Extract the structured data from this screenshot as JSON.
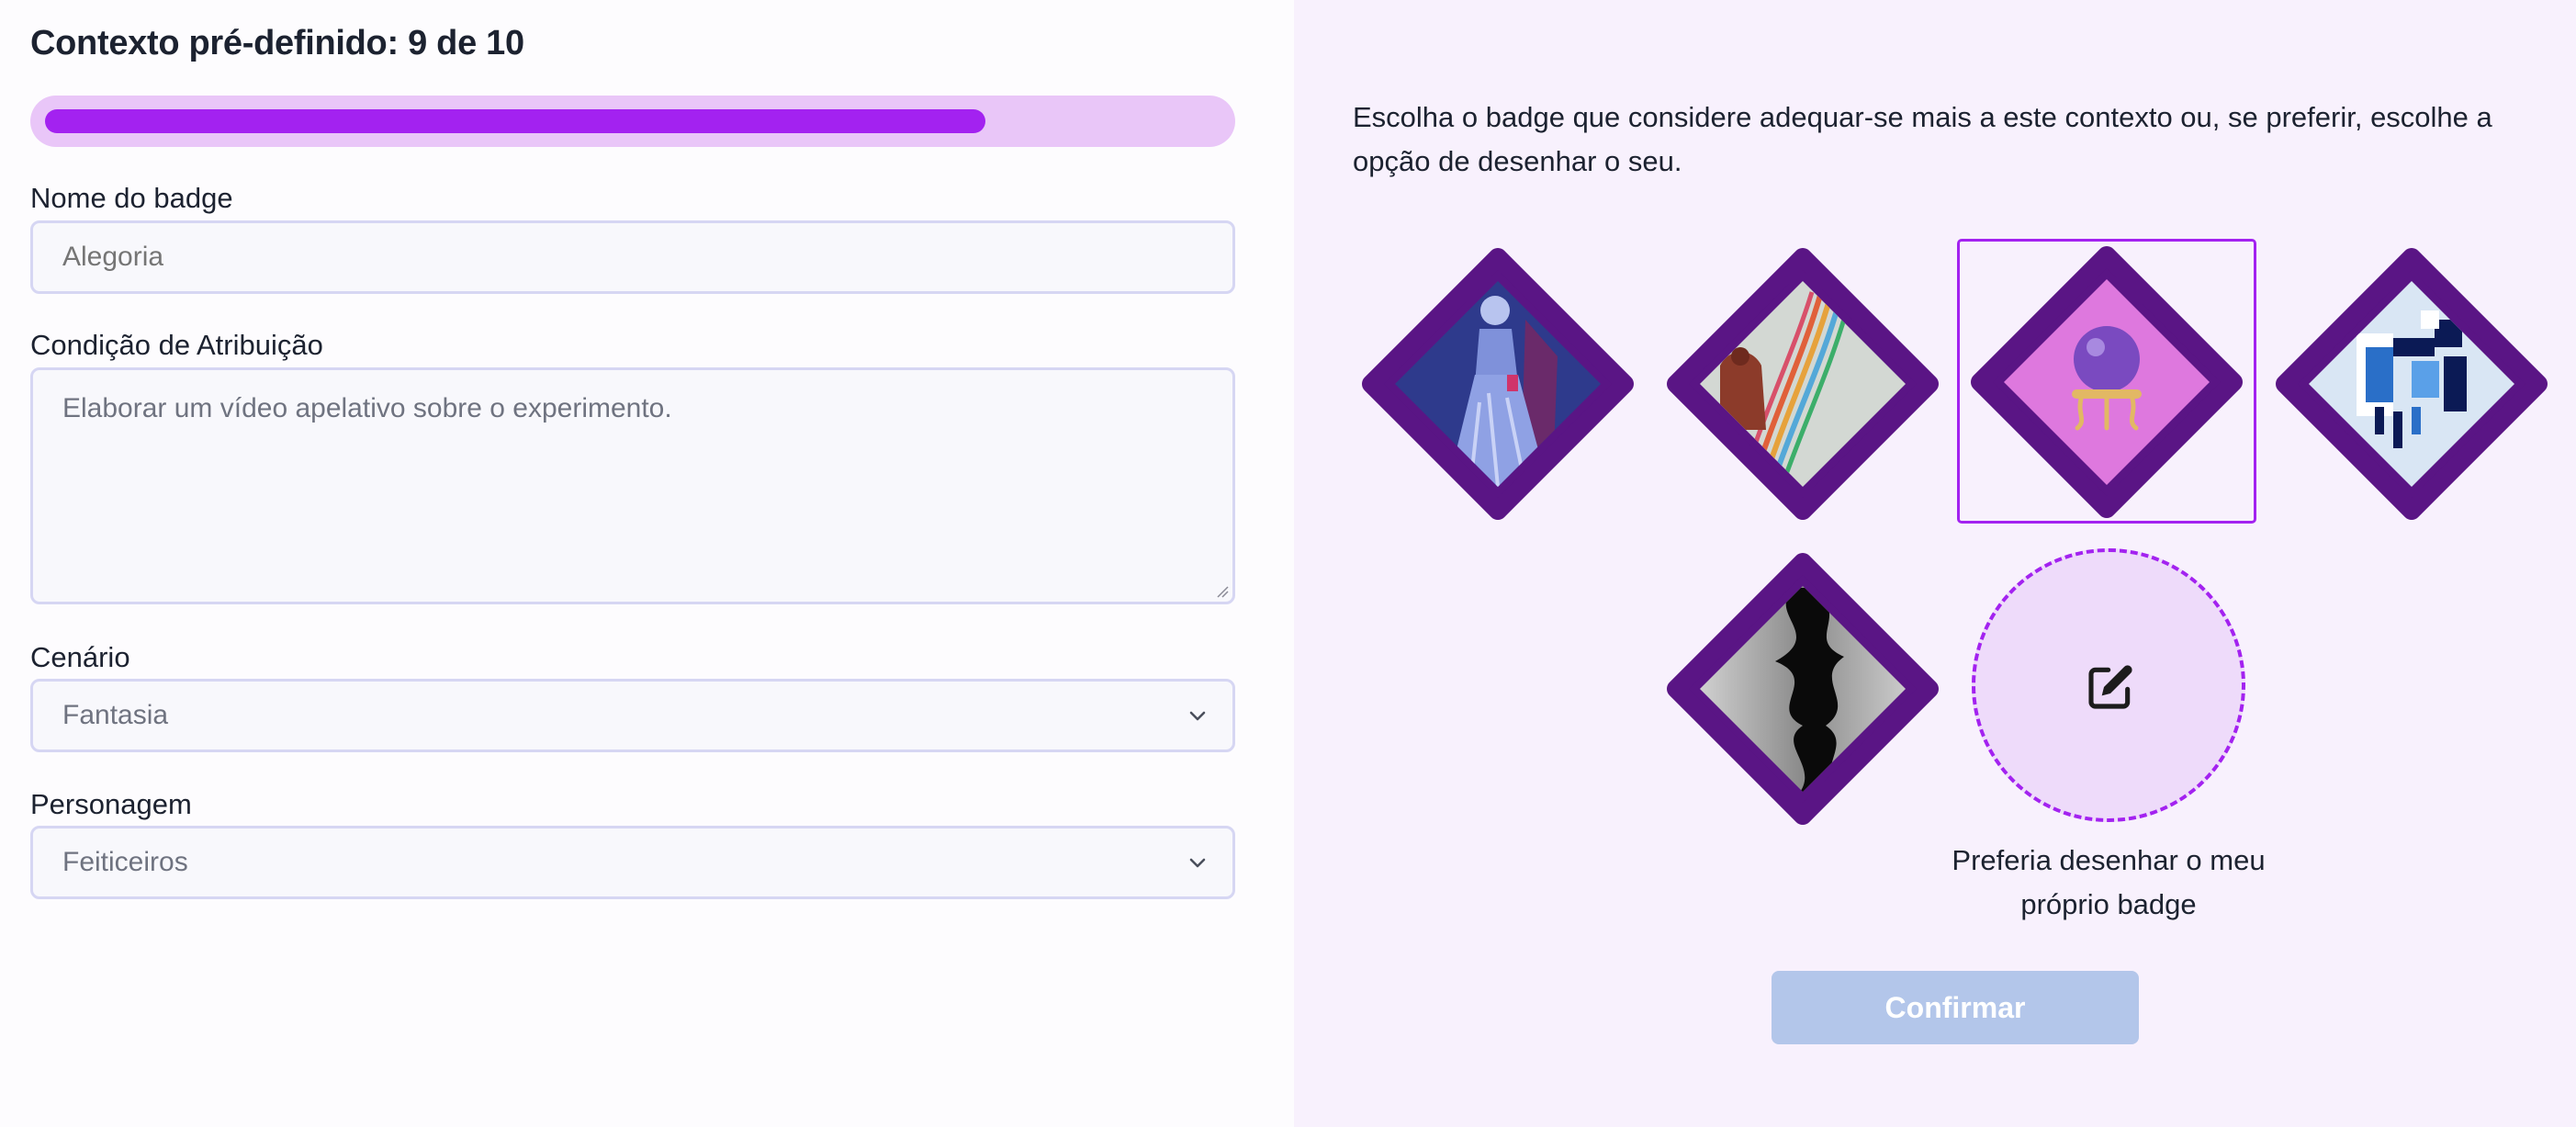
{
  "header": {
    "title": "Contexto pré-definido: 9 de 10"
  },
  "progress": {
    "fraction": 0.8
  },
  "form": {
    "badge_name": {
      "label": "Nome do badge",
      "placeholder": "Alegoria"
    },
    "condition": {
      "label": "Condição de Atribuição",
      "placeholder": "Elaborar um vídeo apelativo sobre o experimento."
    },
    "scenario": {
      "label": "Cenário",
      "value": "Fantasia"
    },
    "character": {
      "label": "Personagem",
      "value": "Feiticeiros"
    }
  },
  "chooser": {
    "instructions": "Escolha o badge que considere adequar-se mais a este contexto ou, se preferir, escolhe a opção de desenhar o seu.",
    "badges": [
      {
        "name": "badge-lady-in-blue-dress",
        "selected": false
      },
      {
        "name": "badge-colored-ribbons",
        "selected": false
      },
      {
        "name": "badge-crystal-ball",
        "selected": true
      },
      {
        "name": "badge-pixel-art-face",
        "selected": false
      },
      {
        "name": "badge-black-smoke",
        "selected": false
      }
    ],
    "draw_own_label": "Preferia desenhar o meu próprio badge",
    "draw_icon": "edit-icon"
  },
  "actions": {
    "confirm_label": "Confirmar"
  },
  "colors": {
    "accent": "#a322f0",
    "badge_border": "#5a1585",
    "confirm_disabled": "#b3c6ea"
  }
}
